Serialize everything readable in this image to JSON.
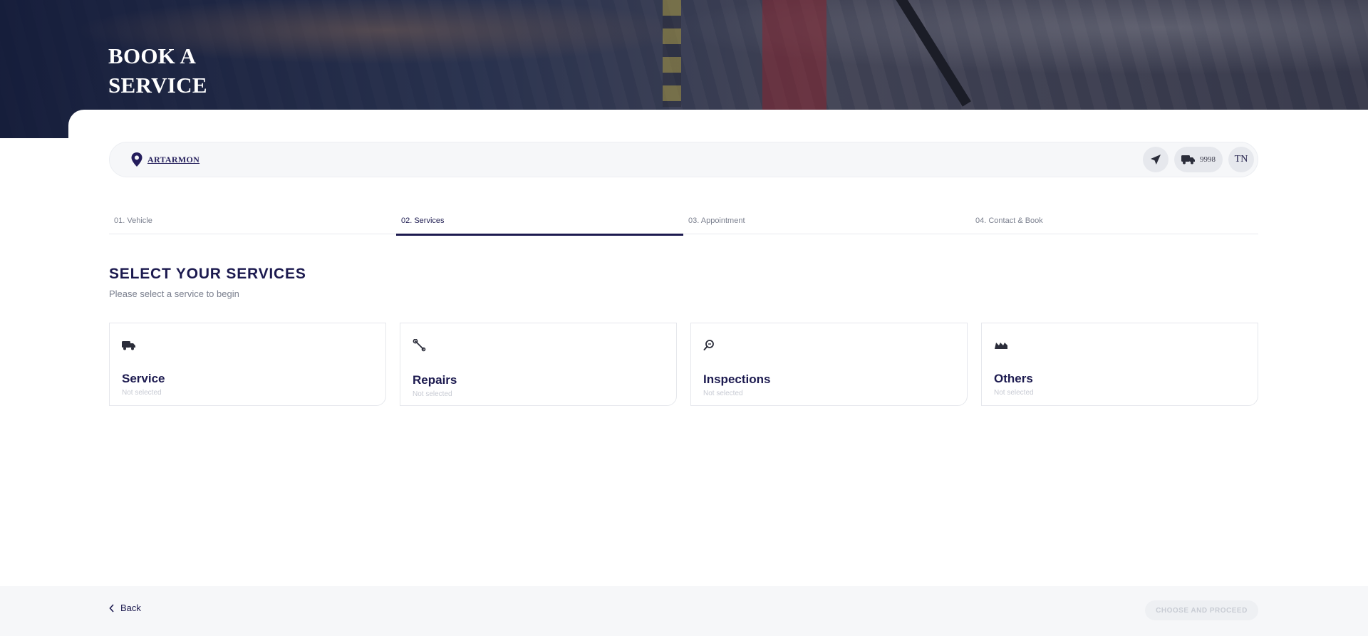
{
  "hero": {
    "title_line1": "BOOK A",
    "title_line2": "SERVICE"
  },
  "location": {
    "label": "ARTARMON",
    "icon": "map-pin-icon"
  },
  "toolbar": {
    "send_icon": "paper-plane-icon",
    "vehicle_icon": "truck-icon",
    "vehicle_count": "9998",
    "user_initials": "TN"
  },
  "steps": [
    {
      "label": "01. Vehicle",
      "active": false
    },
    {
      "label": "02. Services",
      "active": true
    },
    {
      "label": "03. Appointment",
      "active": false
    },
    {
      "label": "04. Contact & Book",
      "active": false
    }
  ],
  "section": {
    "title": "SELECT YOUR SERVICES",
    "subtitle": "Please select a service to begin"
  },
  "cards": [
    {
      "title": "Service",
      "status": "Not selected",
      "icon": "truck-icon"
    },
    {
      "title": "Repairs",
      "status": "Not selected",
      "icon": "wrench-icon"
    },
    {
      "title": "Inspections",
      "status": "Not selected",
      "icon": "magnifier-icon"
    },
    {
      "title": "Others",
      "status": "Not selected",
      "icon": "factory-icon"
    }
  ],
  "footer": {
    "back_label": "Back",
    "proceed_label": "CHOOSE AND PROCEED"
  },
  "colors": {
    "primary": "#1c1a4f",
    "muted": "#7a7f8e",
    "panel": "#f6f7f9"
  }
}
